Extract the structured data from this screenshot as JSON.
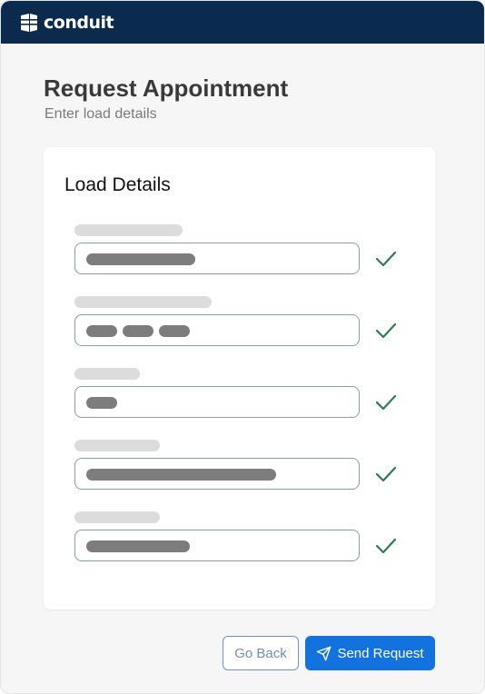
{
  "app": {
    "brand_name": "conduit"
  },
  "page": {
    "title": "Request Appointment",
    "subtitle": "Enter load details"
  },
  "card": {
    "title": "Load Details",
    "fields": [
      {
        "status": "valid"
      },
      {
        "status": "valid"
      },
      {
        "status": "valid"
      },
      {
        "status": "valid"
      },
      {
        "status": "valid"
      }
    ]
  },
  "actions": {
    "back_label": "Go Back",
    "send_label": "Send Request"
  },
  "icons": {
    "brand": "conduit-logo-icon",
    "check": "check-icon",
    "send": "paper-plane-icon"
  },
  "colors": {
    "header_bg": "#0a2a4e",
    "primary": "#1273de",
    "success": "#2e7d4f",
    "skeleton_label": "#dcdcdc",
    "skeleton_value": "#7d7d7d"
  }
}
